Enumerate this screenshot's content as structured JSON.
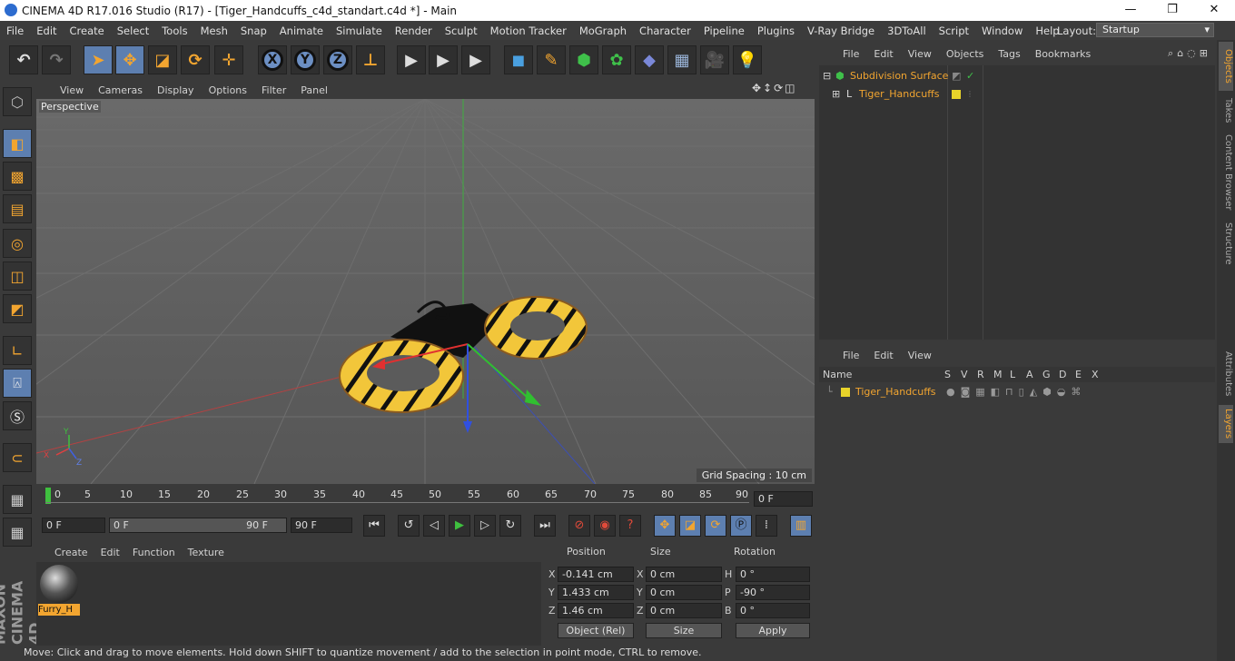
{
  "window": {
    "title": "CINEMA 4D R17.016 Studio (R17) - [Tiger_Handcuffs_c4d_standart.c4d *] - Main",
    "minimize": "—",
    "maximize": "❐",
    "close": "✕"
  },
  "menu": [
    "File",
    "Edit",
    "Create",
    "Select",
    "Tools",
    "Mesh",
    "Snap",
    "Animate",
    "Simulate",
    "Render",
    "Sculpt",
    "Motion Tracker",
    "MoGraph",
    "Character",
    "Pipeline",
    "Plugins",
    "V-Ray Bridge",
    "3DToAll",
    "Script",
    "Window",
    "Help"
  ],
  "layout": {
    "label": "Layout:",
    "value": "Startup"
  },
  "toolbar": {
    "undo": "↶",
    "redo": "↷",
    "x_axis": "X",
    "y_axis": "Y",
    "z_axis": "Z"
  },
  "viewport": {
    "menu": [
      "View",
      "Cameras",
      "Display",
      "Options",
      "Filter",
      "Panel"
    ],
    "label": "Perspective",
    "grid_spacing": "Grid Spacing : 10 cm",
    "nav_icons": "✥↕⟳◫",
    "axis_x": "X",
    "axis_y": "Y",
    "axis_z": "Z"
  },
  "timeline": {
    "ticks": [
      "0",
      "5",
      "10",
      "15",
      "20",
      "25",
      "30",
      "35",
      "40",
      "45",
      "50",
      "55",
      "60",
      "65",
      "70",
      "75",
      "80",
      "85",
      "90"
    ],
    "current_frame": "0 F",
    "start_frame": "0 F",
    "range_start": "0 F",
    "range_end": "90 F",
    "end_frame": "90 F"
  },
  "material_manager": {
    "menu": [
      "Create",
      "Edit",
      "Function",
      "Texture"
    ],
    "material_name": "Furry_H"
  },
  "coordinates": {
    "headers": [
      "Position",
      "Size",
      "Rotation"
    ],
    "rows": [
      {
        "axis": "X",
        "pos": "-0.141 cm",
        "size_axis": "X",
        "size": "0 cm",
        "rot_axis": "H",
        "rot": "0 °"
      },
      {
        "axis": "Y",
        "pos": "1.433 cm",
        "size_axis": "Y",
        "size": "0 cm",
        "rot_axis": "P",
        "rot": "-90 °"
      },
      {
        "axis": "Z",
        "pos": "1.46 cm",
        "size_axis": "Z",
        "size": "0 cm",
        "rot_axis": "B",
        "rot": "0 °"
      }
    ],
    "mode": "Object (Rel)",
    "size_mode": "Size",
    "apply": "Apply"
  },
  "status": "Move: Click and drag to move elements. Hold down SHIFT to quantize movement / add to the selection in point mode, CTRL to remove.",
  "objects_panel": {
    "menu": [
      "File",
      "Edit",
      "View",
      "Objects",
      "Tags",
      "Bookmarks"
    ],
    "items": [
      {
        "name": "Subdivision Surface"
      },
      {
        "name": "Tiger_Handcuffs"
      }
    ]
  },
  "layers_panel": {
    "menu": [
      "File",
      "Edit",
      "View"
    ],
    "columns": [
      "Name",
      "S",
      "V",
      "R",
      "M",
      "L",
      "A",
      "G",
      "D",
      "E",
      "X"
    ],
    "items": [
      {
        "name": "Tiger_Handcuffs"
      }
    ]
  },
  "side_tabs": [
    "Objects",
    "Takes",
    "Content Browser",
    "Structure",
    "Attributes",
    "Layers"
  ],
  "brand": "MAXON CINEMA 4D"
}
